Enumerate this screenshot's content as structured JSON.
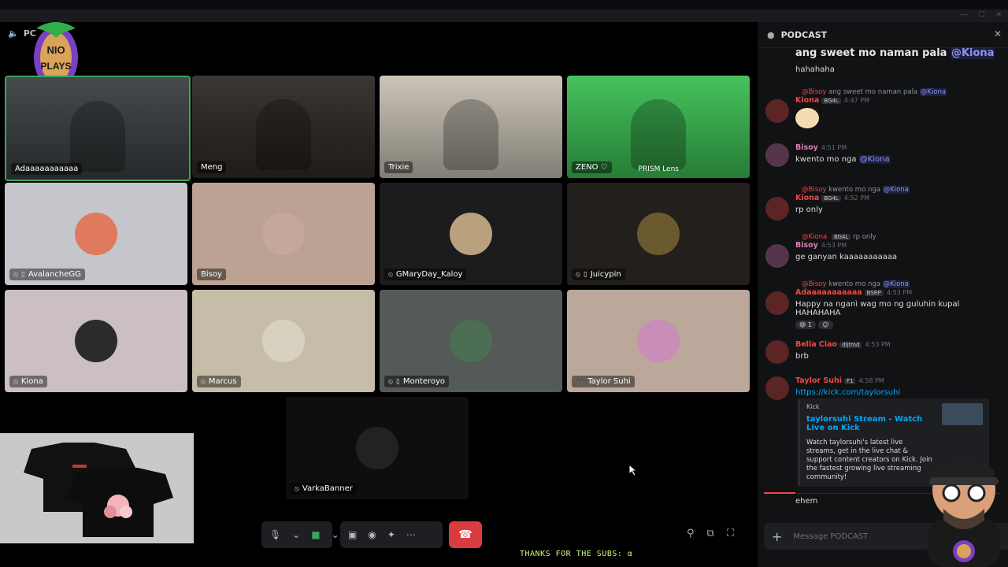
{
  "call": {
    "title": "PC",
    "logo_text": "NIO PLAYS"
  },
  "tiles": [
    {
      "name": "Adaaaaaaaaaaa",
      "bg": "#3a3f41",
      "type": "video"
    },
    {
      "name": "Meng",
      "bg": "#2e2a25",
      "type": "video"
    },
    {
      "name": "Trixie",
      "bg": "#c8c1b4",
      "type": "video"
    },
    {
      "name": "ZENO ♡",
      "bg": "#3bbf53",
      "type": "video",
      "overlay": "PRISM Lens"
    },
    {
      "name": "AvalancheGG",
      "bg": "#c4c6cb",
      "type": "avatar",
      "avatar_color": "#e07a5f",
      "muted": true,
      "mobile": true
    },
    {
      "name": "Bisoy",
      "bg": "#bba293",
      "type": "avatar",
      "avatar_color": "#c5a89a"
    },
    {
      "name": "GMaryDay_Kaloy",
      "bg": "#1c1c1f",
      "type": "avatar",
      "avatar_color": "#b9a17e",
      "muted": true
    },
    {
      "name": "Juicypin",
      "bg": "#221f1c",
      "type": "avatar",
      "avatar_color": "#6b5a2f",
      "muted": true,
      "mobile": true
    },
    {
      "name": "Kiona",
      "bg": "#cbbfc3",
      "type": "avatar",
      "avatar_color": "#2b2b2b",
      "muted": true
    },
    {
      "name": "Marcus",
      "bg": "#c6bda8",
      "type": "avatar",
      "avatar_color": "#d9d1c0",
      "muted": true
    },
    {
      "name": "Monteroyo",
      "bg": "#545a55",
      "type": "avatar",
      "avatar_color": "#4c6e55",
      "muted": true,
      "mobile": true
    },
    {
      "name": "Taylor Suhi",
      "bg": "#bba89b",
      "type": "avatar",
      "avatar_color": "#c98db8",
      "deafened": true
    },
    {
      "name": "VarkaBanner",
      "bg": "#0e0e10",
      "type": "avatar",
      "avatar_color": "#222",
      "muted": true
    }
  ],
  "ticker": "THANKS FOR THE SUBS: α",
  "panel": {
    "title": "PODCAST",
    "top_partial": "ang sweet mo naman pala",
    "top_mention": "@Kiona",
    "top_line2": "hahahaha",
    "messages": [
      {
        "reply_user": "@Bisoy",
        "reply_text": "ang sweet mo naman pala",
        "reply_mention": "@Kiona",
        "user": "Kiona",
        "tag": "BG4L",
        "time": "4:47 PM",
        "text": "",
        "name_color": "#f04747"
      },
      {
        "user": "Bisoy",
        "time": "4:51 PM",
        "text": "kwento mo nga",
        "mention": "@Kiona",
        "name_color": "#e07bb8"
      },
      {
        "reply_user": "@Bisoy",
        "reply_text": "kwento mo nga",
        "reply_mention": "@Kiona",
        "user": "Kiona",
        "tag": "BG4L",
        "time": "4:52 PM",
        "text": "rp only",
        "name_color": "#f04747"
      },
      {
        "reply_user": "@Kiona",
        "reply_text": "rp only",
        "reply_tag": "BG4L",
        "user": "Bisoy",
        "time": "4:53 PM",
        "text": "ge ganyan kaaaaaaaaaaa",
        "name_color": "#e07bb8"
      },
      {
        "reply_user": "@Bisoy",
        "reply_text": "kwento mo nga",
        "reply_mention": "@Kiona",
        "user": "Adaaaaaaaaaaa",
        "tag": "BSRP",
        "time": "4:53 PM",
        "text": "Happy na nganì wag mo ng guluhin kupal HAHAHAHA",
        "name_color": "#f04747",
        "reaction": "1"
      },
      {
        "user": "Bella Ciao",
        "tag": "dljtmd",
        "time": "4:53 PM",
        "text": "brb",
        "name_color": "#f04747"
      },
      {
        "user": "Taylor Suhi",
        "tag": "F1",
        "time": "4:58 PM",
        "text": "https://kick.com/taylorsuhi",
        "name_color": "#f04747",
        "link": true
      }
    ],
    "embed": {
      "provider": "Kick",
      "title": "taylorsuhi Stream - Watch Live on Kick",
      "desc": "Watch taylorsuhi's latest live streams, get in the live chat & support content creators on Kick. Join the fastest growing live streaming community!"
    },
    "last_text": "ehem",
    "input_placeholder": "Message PODCAST"
  }
}
